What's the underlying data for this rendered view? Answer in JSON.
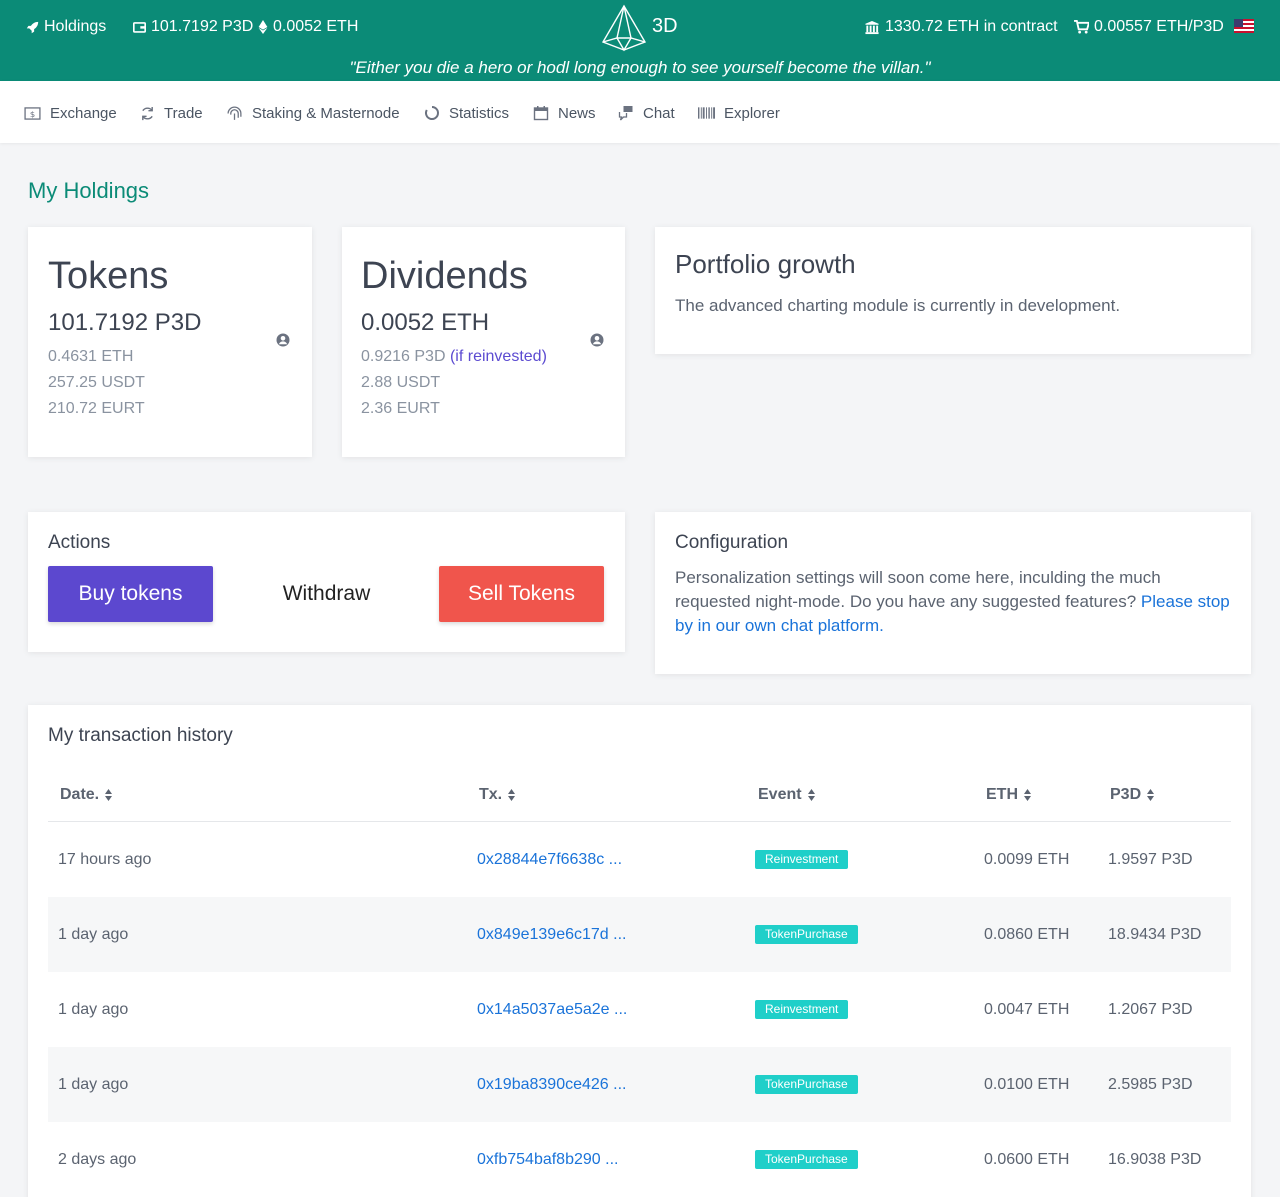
{
  "topbar": {
    "holdings_label": "Holdings",
    "tokens_value": "101.7192 P3D",
    "eth_value": "0.0052 ETH",
    "logo_text": "3D",
    "contract_value": "1330.72 ETH in contract",
    "price_value": "0.00557 ETH/P3D",
    "quote": "\"Either you die a hero or hodl long enough to see yourself become the villan.\""
  },
  "nav": [
    {
      "label": "Exchange",
      "icon": "dollar-bill-icon"
    },
    {
      "label": "Trade",
      "icon": "refresh-icon"
    },
    {
      "label": "Staking & Masternode",
      "icon": "fingerprint-icon"
    },
    {
      "label": "Statistics",
      "icon": "circle-notch-icon"
    },
    {
      "label": "News",
      "icon": "calendar-icon"
    },
    {
      "label": "Chat",
      "icon": "chat-icon"
    },
    {
      "label": "Explorer",
      "icon": "barcode-icon"
    }
  ],
  "page_title": "My Holdings",
  "tokens_card": {
    "title": "Tokens",
    "main": "101.7192 P3D",
    "eth": "0.4631 ETH",
    "usdt": "257.25 USDT",
    "eurt": "210.72 EURT"
  },
  "dividends_card": {
    "title": "Dividends",
    "main": "0.0052 ETH",
    "p3d": "0.9216 P3D",
    "reinvest_note": "(if reinvested)",
    "usdt": "2.88 USDT",
    "eurt": "2.36 EURT"
  },
  "portfolio": {
    "title": "Portfolio growth",
    "text": "The advanced charting module is currently in development."
  },
  "actions": {
    "title": "Actions",
    "buy": "Buy tokens",
    "withdraw": "Withdraw",
    "sell": "Sell Tokens"
  },
  "config": {
    "title": "Configuration",
    "text": "Personalization settings will soon come here, inculding the much requested night-mode. Do you have any suggested features? ",
    "link": "Please stop by in our own chat platform."
  },
  "history": {
    "title": "My transaction history",
    "headers": [
      "Date.",
      "Tx.",
      "Event",
      "ETH",
      "P3D"
    ],
    "rows": [
      {
        "date": "17 hours ago",
        "tx": "0x28844e7f6638c ...",
        "event": "Reinvestment",
        "eth": "0.0099 ETH",
        "p3d": "1.9597 P3D"
      },
      {
        "date": "1 day ago",
        "tx": "0x849e139e6c17d ...",
        "event": "TokenPurchase",
        "eth": "0.0860 ETH",
        "p3d": "18.9434 P3D"
      },
      {
        "date": "1 day ago",
        "tx": "0x14a5037ae5a2e ...",
        "event": "Reinvestment",
        "eth": "0.0047 ETH",
        "p3d": "1.2067 P3D"
      },
      {
        "date": "1 day ago",
        "tx": "0x19ba8390ce426 ...",
        "event": "TokenPurchase",
        "eth": "0.0100 ETH",
        "p3d": "2.5985 P3D"
      },
      {
        "date": "2 days ago",
        "tx": "0xfb754baf8b290 ...",
        "event": "TokenPurchase",
        "eth": "0.0600 ETH",
        "p3d": "16.9038 P3D"
      }
    ]
  },
  "colors": {
    "brand": "#0b8b77",
    "buy": "#5c48cf",
    "sell": "#f0554c",
    "badge": "#1fcfc9",
    "link": "#1a73d9"
  }
}
